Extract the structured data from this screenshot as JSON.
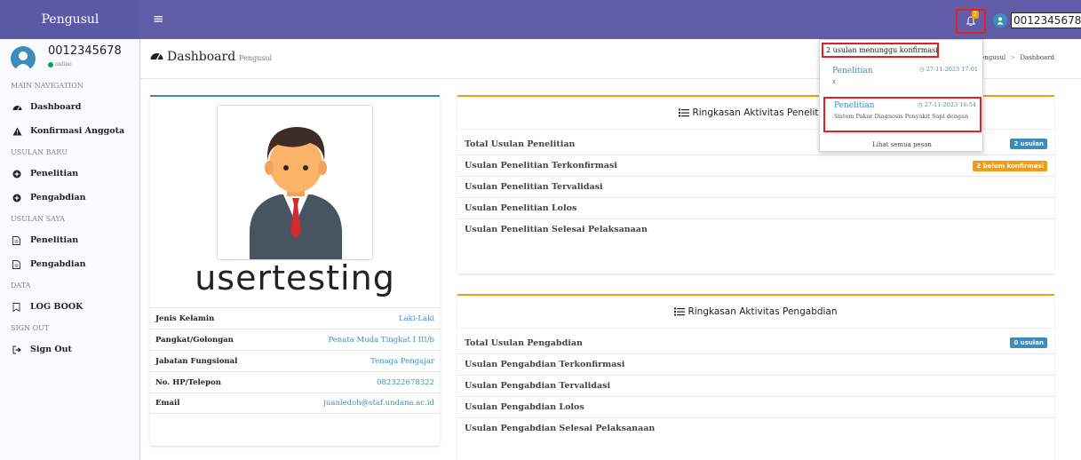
{
  "app": {
    "logo": "Pengusul"
  },
  "topbar": {
    "notif_count": "2",
    "username": "0012345678"
  },
  "sidebar": {
    "user_name": "0012345678",
    "user_status": "online",
    "sections": {
      "main": "MAIN NAVIGATION",
      "usulan_baru": "USULAN BARU",
      "usulan_saya": "USULAN SAYA",
      "data": "DATA",
      "sign_out": "SIGN OUT"
    },
    "items": {
      "dashboard": "Dashboard",
      "konfirmasi": "Konfirmasi Anggota",
      "baru_penelitian": "Penelitian",
      "baru_pengabdian": "Pengabdian",
      "saya_penelitian": "Penelitian",
      "saya_pengabdian": "Pengabdian",
      "logbook": "LOG BOOK",
      "signout": "Sign Out"
    }
  },
  "header": {
    "title": "Dashboard",
    "subtitle": "Pengusul",
    "breadcrumb": [
      "Pengusul",
      "Dashboard"
    ]
  },
  "profile": {
    "username": "usertesting",
    "rows": [
      {
        "label": "Jenis Kelamin",
        "value": "Laki-Laki"
      },
      {
        "label": "Pangkat/Golongan",
        "value": "Penata Muda Tingkat I III/b"
      },
      {
        "label": "Jabatan Fungsional",
        "value": "Tenaga Pengajar"
      },
      {
        "label": "No. HP/Telepon",
        "value": "082322678322"
      },
      {
        "label": "Email",
        "value": "juanledoh@staf.undana.ac.id"
      }
    ]
  },
  "penelitian": {
    "title": "Ringkasan Aktivitas Penelitian",
    "rows": [
      {
        "label": "Total Usulan Penelitian",
        "badge": "2 usulan"
      },
      {
        "label": "Usulan Penelitian Terkonfirmasi",
        "badge": "2 belum konfirmasi"
      },
      {
        "label": "Usulan Penelitian Tervalidasi"
      },
      {
        "label": "Usulan Penelitian Lolos"
      },
      {
        "label": "Usulan Penelitian Selesai Pelaksanaan"
      }
    ]
  },
  "pengabdian": {
    "title": "Ringkasan Aktivitas Pengabdian",
    "rows": [
      {
        "label": "Total Usulan Pengabdian",
        "badge": "0 usulan"
      },
      {
        "label": "Usulan Pengabdian Terkonfirmasi"
      },
      {
        "label": "Usulan Pengabdian Tervalidasi"
      },
      {
        "label": "Usulan Pengabdian Lolos"
      },
      {
        "label": "Usulan Pengabdian Selesai Pelaksanaan"
      }
    ]
  },
  "notifications": {
    "header": "2 usulan menunggu konfirmasi",
    "items": [
      {
        "title": "Penelitian",
        "time": "27-11-2023 17:01",
        "desc": "x"
      },
      {
        "title": "Penelitian",
        "time": "27-11-2023 16:54",
        "desc": "Sistem Pakar Diagnosis Penyakit Sapi dengan M..."
      }
    ],
    "footer": "Lihat semua pesan"
  },
  "colors": {
    "header": "#605ca8",
    "accent": "#3c8dbc",
    "warning": "#f39c12",
    "highlight": "#e31e24"
  }
}
